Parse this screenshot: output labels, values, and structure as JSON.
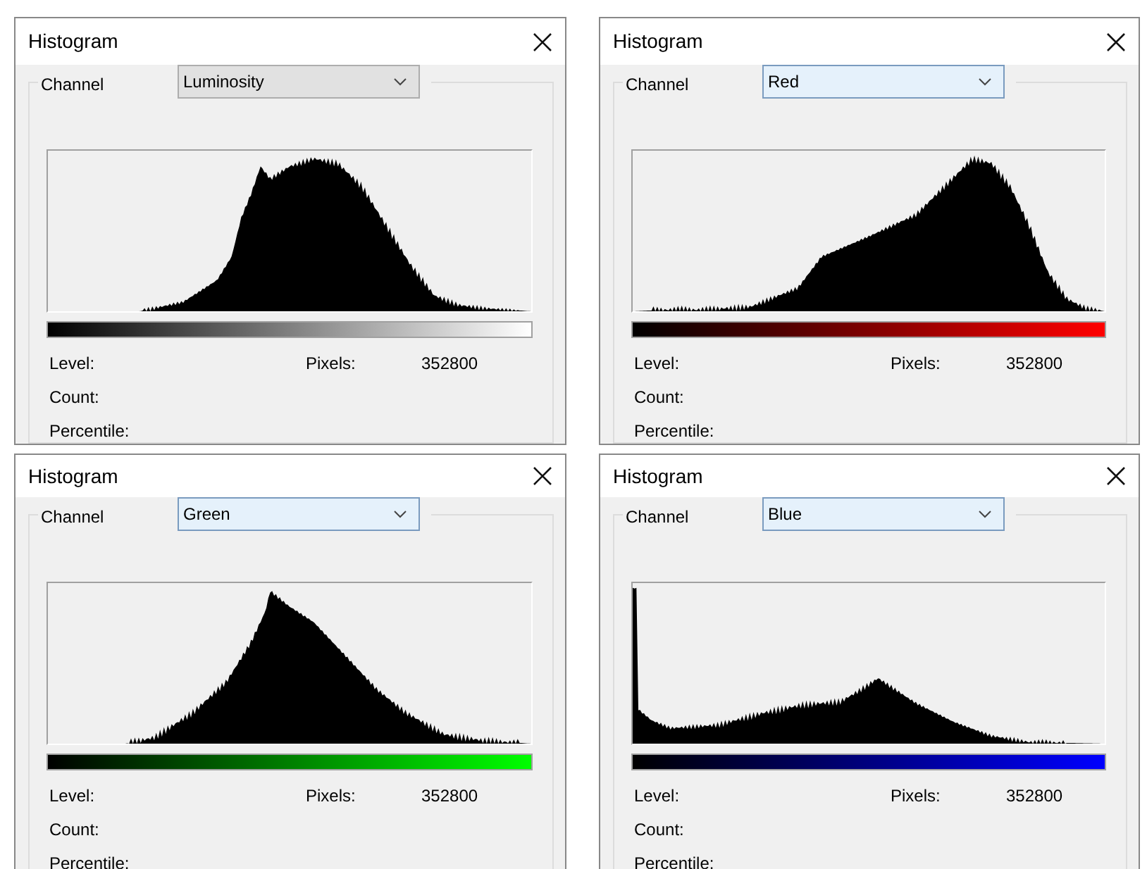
{
  "dialogs": [
    {
      "title": "Histogram",
      "channel_label": "Channel",
      "channel": {
        "value": "Luminosity",
        "focused": false
      },
      "color": "#ffffff",
      "level_label": "Level:",
      "pixels_label": "Pixels:",
      "pixels_value": "352800",
      "count_label": "Count:",
      "percentile_label": "Percentile:"
    },
    {
      "title": "Histogram",
      "channel_label": "Channel",
      "channel": {
        "value": "Red",
        "focused": true
      },
      "color": "#ff0000",
      "level_label": "Level:",
      "pixels_label": "Pixels:",
      "pixels_value": "352800",
      "count_label": "Count:",
      "percentile_label": "Percentile:"
    },
    {
      "title": "Histogram",
      "channel_label": "Channel",
      "channel": {
        "value": "Green",
        "focused": true
      },
      "color": "#00ff00",
      "level_label": "Level:",
      "pixels_label": "Pixels:",
      "pixels_value": "352800",
      "count_label": "Count:",
      "percentile_label": "Percentile:"
    },
    {
      "title": "Histogram",
      "channel_label": "Channel",
      "channel": {
        "value": "Blue",
        "focused": true
      },
      "color": "#0000ff",
      "level_label": "Level:",
      "pixels_label": "Pixels:",
      "pixels_value": "352800",
      "count_label": "Count:",
      "percentile_label": "Percentile:"
    }
  ]
}
